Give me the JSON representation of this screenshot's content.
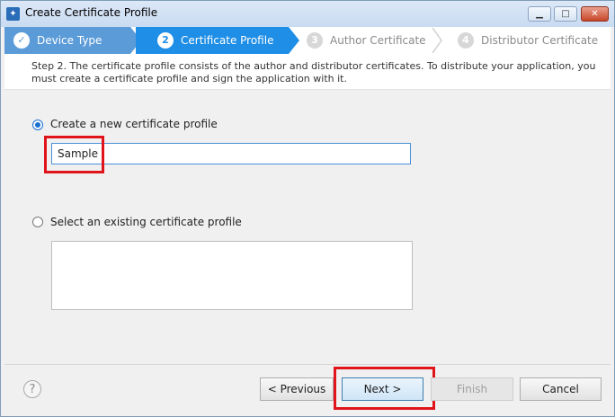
{
  "window": {
    "title": "Create Certificate Profile"
  },
  "titlebar_buttons": {
    "minimize": "▁",
    "maximize": "□",
    "close": "✕"
  },
  "steps": [
    {
      "num": "✓",
      "label": "Device Type"
    },
    {
      "num": "2",
      "label": "Certificate Profile"
    },
    {
      "num": "3",
      "label": "Author Certificate"
    },
    {
      "num": "4",
      "label": "Distributor Certificate"
    }
  ],
  "description": "Step 2. The certificate profile consists of the author and distributor certificates. To distribute your application, you must create a certificate profile and sign the application with it.",
  "options": {
    "create_new_label": "Create a new certificate profile",
    "profile_name_value": "Sample",
    "select_existing_label": "Select an existing certificate profile"
  },
  "footer": {
    "help": "?",
    "previous": "< Previous",
    "next": "Next >",
    "finish": "Finish",
    "cancel": "Cancel"
  }
}
